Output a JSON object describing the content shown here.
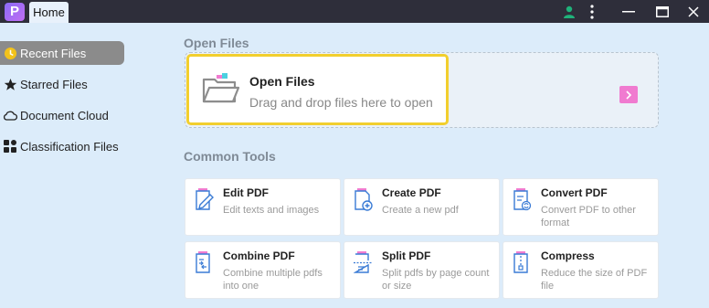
{
  "titlebar": {
    "logo_letter": "P",
    "tab_label": "Home"
  },
  "sidebar": {
    "items": [
      {
        "label": "Recent Files",
        "icon": "clock-icon",
        "active": true
      },
      {
        "label": "Starred Files",
        "icon": "star-icon",
        "active": false
      },
      {
        "label": "Document Cloud",
        "icon": "cloud-icon",
        "active": false
      },
      {
        "label": "Classification Files",
        "icon": "grid-icon",
        "active": false
      }
    ]
  },
  "main": {
    "open_section_title": "Open Files",
    "open_card": {
      "title": "Open Files",
      "subtitle": "Drag and drop files here to open"
    },
    "tools_section_title": "Common Tools",
    "tools": [
      {
        "name": "Edit PDF",
        "desc": "Edit texts and images",
        "icon": "edit-pdf-icon"
      },
      {
        "name": "Create PDF",
        "desc": "Create a new pdf",
        "icon": "create-pdf-icon"
      },
      {
        "name": "Convert PDF",
        "desc": "Convert PDF to other format",
        "icon": "convert-pdf-icon"
      },
      {
        "name": "Combine PDF",
        "desc": "Combine multiple pdfs into one",
        "icon": "combine-pdf-icon"
      },
      {
        "name": "Split PDF",
        "desc": "Split pdfs by page count or size",
        "icon": "split-pdf-icon"
      },
      {
        "name": "Compress",
        "desc": "Reduce the size of PDF file",
        "icon": "compress-icon"
      }
    ]
  },
  "colors": {
    "accent_yellow": "#f2cf2e",
    "arrow_pink": "#f07bd0",
    "titlebar": "#2e2e3a",
    "background": "#dcecfa",
    "user_green": "#1fb27a"
  }
}
